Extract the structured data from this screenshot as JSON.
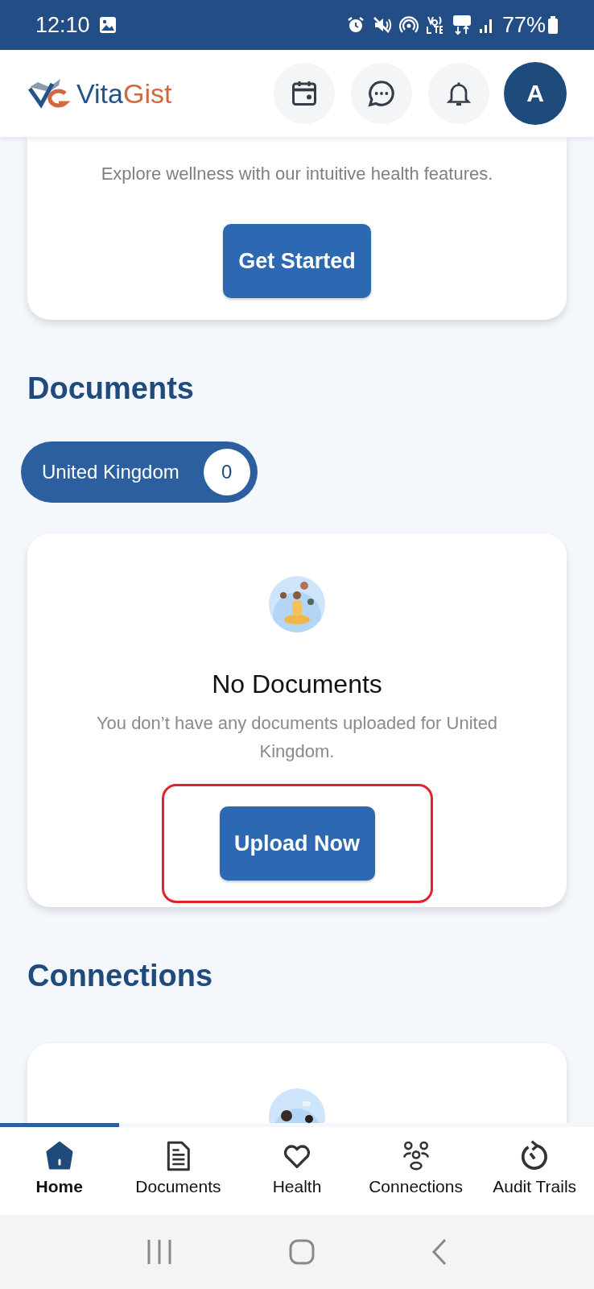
{
  "status_bar": {
    "time": "12:10",
    "battery": "77%"
  },
  "header": {
    "brand": [
      {
        "text": "Vita",
        "color": "#23528a"
      },
      {
        "text": "Gist",
        "color": "#d2693c"
      }
    ],
    "avatar": "A"
  },
  "promo": {
    "subtitle": "Explore wellness with our intuitive health features.",
    "button": "Get Started"
  },
  "documents": {
    "heading": "Documents",
    "filters": [
      {
        "label": "United Kingdom",
        "count": "0",
        "selected": true
      }
    ],
    "empty_state": {
      "title": "No Documents",
      "message": "You don’t have any documents uploaded for United Kingdom.",
      "button": "Upload Now"
    }
  },
  "connections": {
    "heading": "Connections"
  },
  "bottom_nav": [
    {
      "label": "Home",
      "selected": true
    },
    {
      "label": "Documents",
      "selected": false
    },
    {
      "label": "Health",
      "selected": false
    },
    {
      "label": "Connections",
      "selected": false
    },
    {
      "label": "Audit Trails",
      "selected": false
    }
  ]
}
